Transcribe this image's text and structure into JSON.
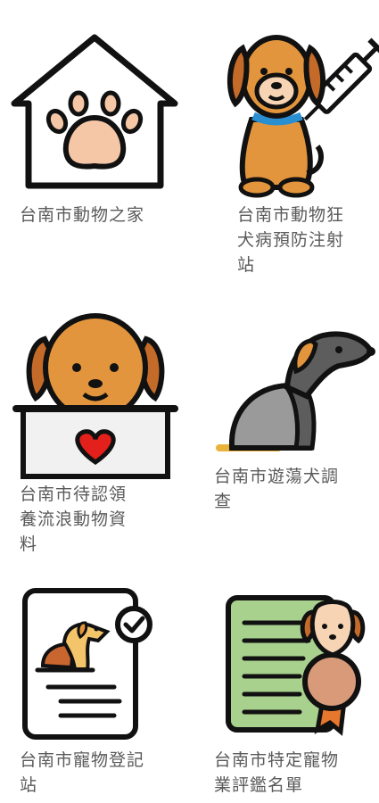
{
  "tiles": [
    {
      "label": "台南市動物之家",
      "icon": "pet-house-icon"
    },
    {
      "label": "台南市動物狂犬病預防注射站",
      "icon": "dog-vaccine-icon"
    },
    {
      "label": "台南市待認領養流浪動物資料",
      "icon": "dog-in-box-icon"
    },
    {
      "label": "台南市遊蕩犬調查",
      "icon": "stray-dog-icon"
    },
    {
      "label": "台南市寵物登記站",
      "icon": "pet-registration-icon"
    },
    {
      "label": "台南市特定寵物業評鑑名單",
      "icon": "certificate-dog-icon"
    }
  ],
  "colors": {
    "stroke": "#111111",
    "dog_orange": "#e2953c",
    "dog_ear": "#c56b2a",
    "muzzle": "#f6d4b4",
    "paw_pad": "#f6c7a7",
    "collar": "#2a8fd1",
    "heart": "#e3201b",
    "box": "#f1f1f1",
    "grey_dog": "#9a9a9a",
    "grey_dog_dark": "#5d5d5d",
    "cert_green": "#a9d18e",
    "medal": "#d99a7a",
    "ribbon": "#e8772e",
    "label_text": "#5a5a5a"
  }
}
